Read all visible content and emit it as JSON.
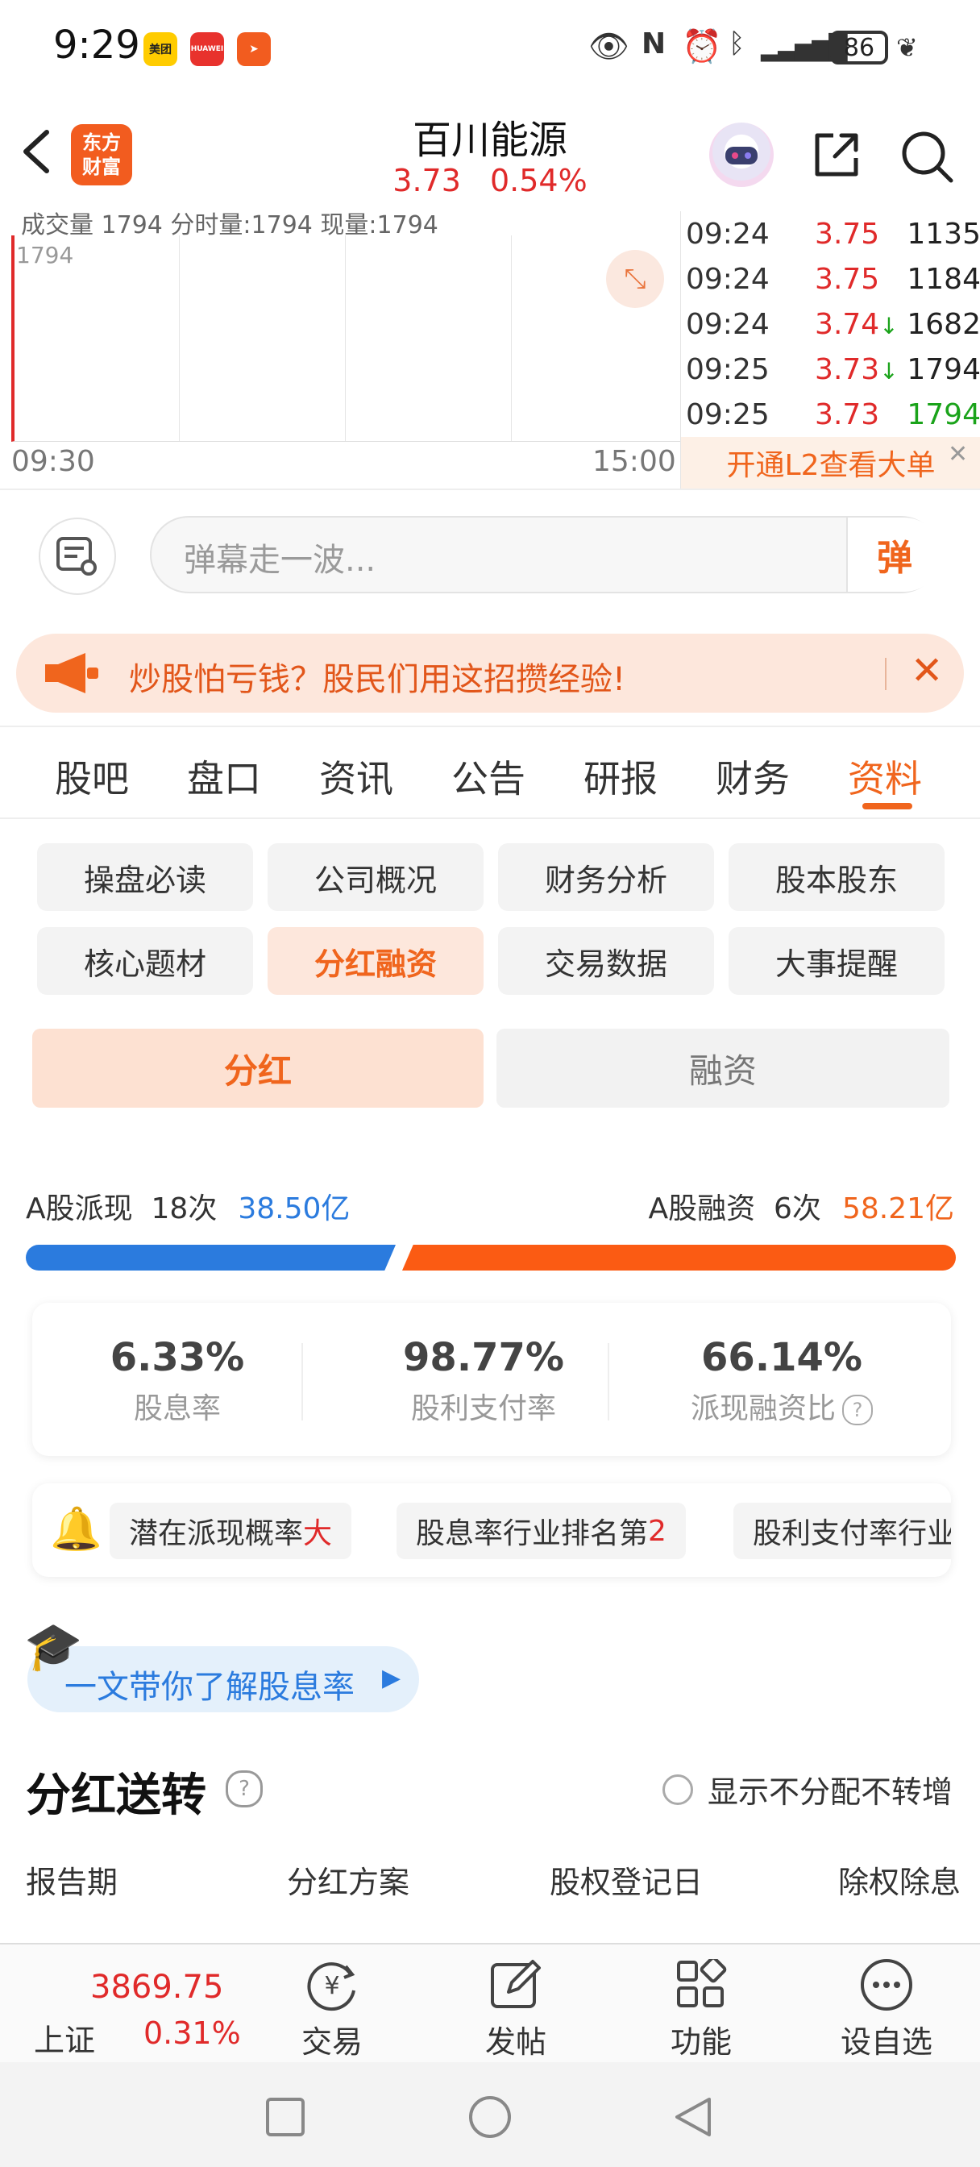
{
  "status_bar": {
    "time": "9:29",
    "apps": [
      "美团",
      "HUAWEI",
      "app"
    ],
    "battery": "86"
  },
  "header": {
    "logo_line1": "东方",
    "logo_line2": "财富",
    "stock_name": "百川能源",
    "price": "3.73",
    "change_pct": "0.54%"
  },
  "chart": {
    "top_cut_text": "成交量 1794 分时量:1794 现量:1794",
    "volume_label": "1794",
    "time_start": "09:30",
    "time_end": "15:00"
  },
  "trades": [
    {
      "time": "09:24",
      "price": "3.75",
      "vol": "1135",
      "arrow": ""
    },
    {
      "time": "09:24",
      "price": "3.75",
      "vol": "1184",
      "arrow": ""
    },
    {
      "time": "09:24",
      "price": "3.74",
      "vol": "1682",
      "arrow": "↓"
    },
    {
      "time": "09:25",
      "price": "3.73",
      "vol": "1794",
      "arrow": "↓"
    },
    {
      "time": "09:25",
      "price": "3.73",
      "vol": "1794",
      "arrow": ""
    }
  ],
  "l2_banner": "开通L2查看大单",
  "danmu": {
    "placeholder": "弹幕走一波...",
    "send_label": "弹"
  },
  "promo": {
    "text": "炒股怕亏钱？股民们用这招攒经验!"
  },
  "main_tabs": [
    "股吧",
    "盘口",
    "资讯",
    "公告",
    "研报",
    "财务",
    "资料"
  ],
  "main_tab_active": "资料",
  "sub_tabs": [
    "操盘必读",
    "公司概况",
    "财务分析",
    "股本股东",
    "核心题材",
    "分红融资",
    "交易数据",
    "大事提醒"
  ],
  "sub_tab_active": "分红融资",
  "segment": {
    "dividend": "分红",
    "financing": "融资"
  },
  "stats": {
    "a_dividend_label": "A股派现",
    "a_dividend_count": "18次",
    "a_dividend_amount": "38.50亿",
    "a_financing_label": "A股融资",
    "a_financing_count": "6次",
    "a_financing_amount": "58.21亿",
    "dividend_share": 0.398
  },
  "metrics": [
    {
      "value": "6.33%",
      "label": "股息率"
    },
    {
      "value": "98.77%",
      "label": "股利支付率"
    },
    {
      "value": "66.14%",
      "label": "派现融资比"
    }
  ],
  "tags": [
    {
      "text": "潜在派现概率",
      "highlight": "大"
    },
    {
      "text": "股息率行业排名第",
      "highlight": "2"
    },
    {
      "text": "股利支付率行业",
      "highlight": ""
    }
  ],
  "learn": {
    "text": "一文带你了解股息率"
  },
  "section": {
    "title": "分红送转",
    "toggle_label": "显示不分配不转增",
    "columns": [
      "报告期",
      "分红方案",
      "股权登记日",
      "除权除息日"
    ]
  },
  "bottom_bar": {
    "index_value": "3869.75",
    "index_name": "上证",
    "index_pct": "0.31%",
    "nav": [
      "交易",
      "发帖",
      "功能",
      "设自选"
    ]
  },
  "colors": {
    "accent": "#f0651d",
    "up": "#e02a2a",
    "down": "#1aa31a",
    "blue": "#2b7bde"
  }
}
